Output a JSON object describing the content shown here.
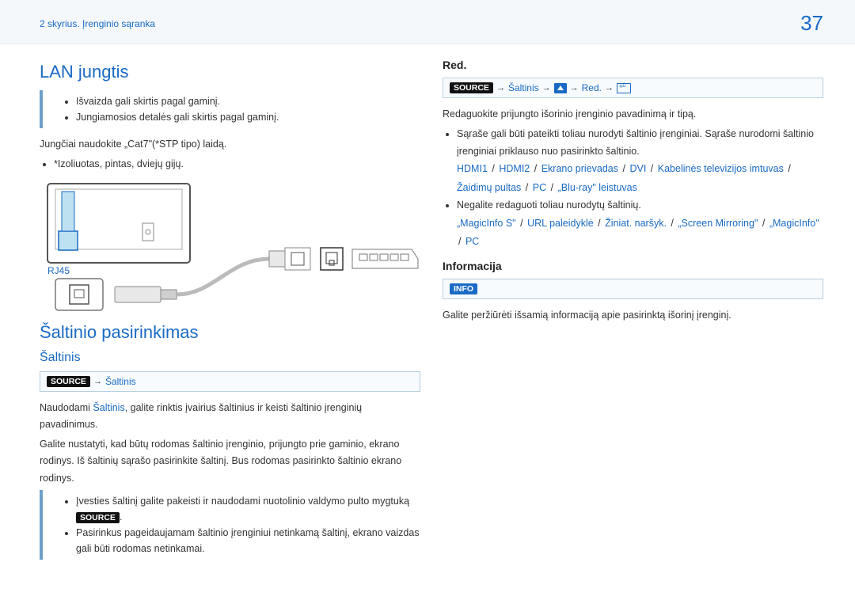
{
  "header": {
    "chapter": "2 skyrius. Įrenginio sąranka",
    "page": "37"
  },
  "left": {
    "h1_lan": "LAN jungtis",
    "note1_a": "Išvaizda gali skirtis pagal gaminį.",
    "note1_b": "Jungiamosios detalės gali skirtis pagal gaminį.",
    "cable_line": "Jungčiai naudokite „Cat7\"(*STP tipo) laidą.",
    "cable_sub": "*Izoliuotas, pintas, dviejų gijų.",
    "rj45": "RJ45",
    "h1_source_sel": "Šaltinio pasirinkimas",
    "h2_source": "Šaltinis",
    "path_source_tag": "SOURCE",
    "path_source_text": "Šaltinis",
    "para_source_1a": "Naudodami ",
    "para_source_1b": "Šaltinis",
    "para_source_1c": ", galite rinktis įvairius šaltinius ir keisti šaltinio įrenginių pavadinimus.",
    "para_source_2": "Galite nustatyti, kad būtų rodomas šaltinio įrenginio, prijungto prie gaminio, ekrano rodinys. Iš šaltinių sąrašo pasirinkite šaltinį. Bus rodomas pasirinkto šaltinio ekrano rodinys.",
    "li_source_a_pre": "Įvesties šaltinį galite pakeisti ir naudodami nuotolinio valdymo pulto mygtuką ",
    "li_source_a_tag": "SOURCE",
    "li_source_a_post": ".",
    "li_source_b": "Pasirinkus pageidaujamam šaltinio įrenginiui netinkamą šaltinį, ekrano vaizdas gali būti rodomas netinkamai."
  },
  "right": {
    "h3_red": "Red.",
    "path_red_tag": "SOURCE",
    "path_red_1": "Šaltinis",
    "path_red_2": "Red.",
    "para_red_1": "Redaguokite prijungto išorinio įrenginio pavadinimą ir tipą.",
    "li_red_a": "Sąraše gali būti pateikti toliau nurodyti šaltinio įrenginiai. Sąraše nurodomi šaltinio įrenginiai priklauso nuo pasirinkto šaltinio.",
    "src_hdmi1": "HDMI1",
    "src_hdmi2": "HDMI2",
    "src_display": "Ekrano prievadas",
    "src_dvi": "DVI",
    "src_cable": "Kabelinės televizijos imtuvas",
    "src_game": "Žaidimų pultas",
    "src_pc": "PC",
    "src_bluray": "„Blu-ray\" leistuvas",
    "li_red_b": "Negalite redaguoti toliau nurodytų šaltinių.",
    "src_magicinfos": "„MagicInfo S\"",
    "src_url": "URL paleidyklė",
    "src_browser": "Žiniat. naršyk.",
    "src_mirror": "„Screen Mirroring\"",
    "src_magicinfo": "„MagicInfo\"",
    "src_pc2": "PC",
    "h3_info": "Informacija",
    "path_info_tag": "INFO",
    "para_info": "Galite peržiūrėti išsamią informaciją apie pasirinktą išorinį įrenginį."
  }
}
